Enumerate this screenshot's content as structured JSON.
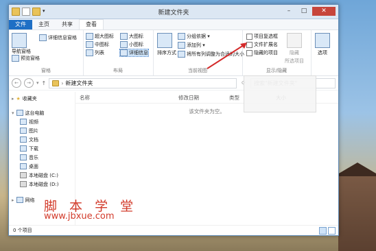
{
  "window": {
    "title": "新建文件夹"
  },
  "tabs": [
    "文件",
    "主页",
    "共享",
    "查看"
  ],
  "ribbon": {
    "panes": {
      "nav_pane": "导航窗格",
      "preview_pane": "预览窗格",
      "details_pane": "详细信息窗格",
      "group_label": "窗格"
    },
    "layout": {
      "extra_large": "超大图标",
      "large": "大图标",
      "medium": "中图标",
      "small": "小图标",
      "list": "列表",
      "details": "详细信息",
      "group_label": "布局"
    },
    "current_view": {
      "sort_by": "排序方式",
      "group_by": "分组依据 ▾",
      "add_columns": "添加列 ▾",
      "fit_columns": "将所有列调整为合适的大小",
      "group_label": "当前视图"
    },
    "show_hide": {
      "item_checkboxes": "项目复选框",
      "file_extensions": "文件扩展名",
      "hidden_items": "隐藏的项目",
      "hide_selected": "隐藏",
      "hide_selected_sub": "所选项目",
      "group_label": "显示/隐藏"
    },
    "options": "选项"
  },
  "address": {
    "path": "新建文件夹",
    "search_placeholder": "搜索\"新建文件夹\""
  },
  "nav": {
    "favorites": "收藏夹",
    "this_pc": "这台电脑",
    "items": [
      "视频",
      "图片",
      "文档",
      "下载",
      "音乐",
      "桌面",
      "本地磁盘 (C:)",
      "本地磁盘 (D:)"
    ],
    "network": "网络"
  },
  "columns": {
    "name": "名称",
    "date": "修改日期",
    "type": "类型",
    "size": "大小"
  },
  "empty_message": "该文件夹为空。",
  "status": {
    "items": "0 个项目"
  },
  "overlay": {
    "watermark_cn": "脚 本 学 堂",
    "watermark_url": "www.jbxue.com"
  },
  "colors": {
    "accent": "#1e6fc5",
    "arrow": "#d42a2a"
  }
}
